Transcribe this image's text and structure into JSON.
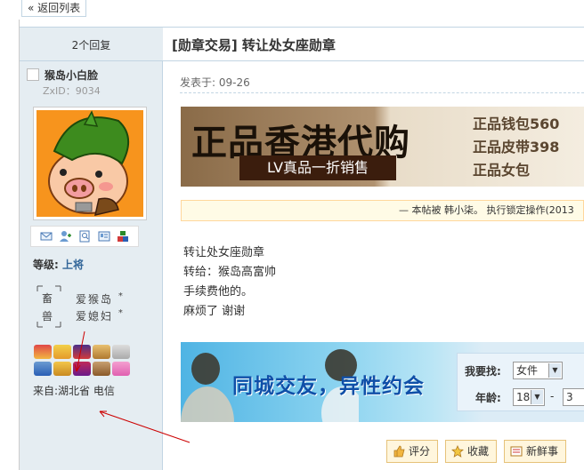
{
  "topbar": {
    "back_label": "« 返回列表"
  },
  "thread": {
    "reply_count": "2个回复",
    "title": "[勋章交易] 转让处女座勋章"
  },
  "user": {
    "name": "猴岛小白脸",
    "zxid": "ZxID：9034",
    "level_label": "等级:",
    "level_value": "上将",
    "signature": {
      "seal_top": "畜",
      "seal_bottom": "兽",
      "line1": "爱猴岛",
      "line2": "爱媳妇",
      "star": "*"
    },
    "from": "来自:湖北省 电信"
  },
  "post": {
    "meta": "发表于: 09-26",
    "notice": "— 本帖被 韩小柒。 执行锁定操作(2013",
    "body": [
      "转让处女座勋章",
      "转给：猴岛高富帅",
      "手续费他的。",
      "麻烦了 谢谢"
    ]
  },
  "ad1": {
    "headline": "正品香港代购",
    "bar": "LV真品一折销售",
    "right_lines": [
      "正品钱包560",
      "正品皮带398",
      "正品女包"
    ]
  },
  "ad2": {
    "headline": "同城交友，异性约会",
    "search_label": "我要找:",
    "search_value": "女件",
    "age_label": "年龄:",
    "age_from": "18",
    "age_sep": "-",
    "age_to": "3"
  },
  "actions": [
    {
      "label": "评分"
    },
    {
      "label": "收藏"
    },
    {
      "label": "新鲜事"
    }
  ],
  "colors": {
    "accent": "#336699",
    "side_bg": "#e5edf2",
    "annotation": "#cc0000"
  }
}
